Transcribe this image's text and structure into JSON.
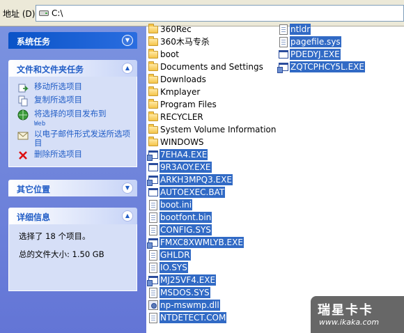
{
  "address": {
    "label": "地址 (D)",
    "path": "C:\\"
  },
  "sidebar": {
    "system_tasks": {
      "title": "系统任务"
    },
    "file_tasks": {
      "title": "文件和文件夹任务",
      "items": [
        {
          "label": "移动所选项目",
          "icon": "move-icon"
        },
        {
          "label": "复制所选项目",
          "icon": "copy-icon"
        },
        {
          "label": "将选择的项目发布到",
          "sub": "Web",
          "icon": "web-publish-icon"
        },
        {
          "label": "以电子邮件形式发送所选项目",
          "icon": "email-icon"
        },
        {
          "label": "删除所选项目",
          "icon": "delete-icon"
        }
      ]
    },
    "other_places": {
      "title": "其它位置"
    },
    "details": {
      "title": "详细信息",
      "selected": "选择了 18 个项目。",
      "total_size": "总的文件大小: 1.50 GB"
    }
  },
  "files": {
    "col1": [
      {
        "name": "360Rec",
        "type": "folder",
        "selected": false
      },
      {
        "name": "360木马专杀",
        "type": "folder",
        "selected": false
      },
      {
        "name": "boot",
        "type": "folder",
        "selected": false
      },
      {
        "name": "Documents and Settings",
        "type": "folder",
        "selected": false
      },
      {
        "name": "Downloads",
        "type": "folder",
        "selected": false
      },
      {
        "name": "Kmplayer",
        "type": "folder",
        "selected": false
      },
      {
        "name": "Program Files",
        "type": "folder",
        "selected": false
      },
      {
        "name": "RECYCLER",
        "type": "folder",
        "selected": false
      },
      {
        "name": "System Volume Information",
        "type": "folder",
        "selected": false
      },
      {
        "name": "WINDOWS",
        "type": "folder",
        "selected": false
      },
      {
        "name": "7EHA4.EXE",
        "type": "exe-alt",
        "selected": true
      },
      {
        "name": "9R3AOY.EXE",
        "type": "exe",
        "selected": true
      },
      {
        "name": "ARKH3MPQ3.EXE",
        "type": "exe-alt",
        "selected": true
      },
      {
        "name": "AUTOEXEC.BAT",
        "type": "exe",
        "selected": true
      },
      {
        "name": "boot.ini",
        "type": "doc",
        "selected": true
      },
      {
        "name": "bootfont.bin",
        "type": "doc",
        "selected": true
      },
      {
        "name": "CONFIG.SYS",
        "type": "doc",
        "selected": true
      },
      {
        "name": "FMXC8XWMLYB.EXE",
        "type": "exe-alt",
        "selected": true
      },
      {
        "name": "GHLDR",
        "type": "doc",
        "selected": true
      },
      {
        "name": "IO.SYS",
        "type": "doc",
        "selected": true
      },
      {
        "name": "MJ25VF4.EXE",
        "type": "exe-alt",
        "selected": true
      },
      {
        "name": "MSDOS.SYS",
        "type": "doc",
        "selected": true
      },
      {
        "name": "np-mswmp.dll",
        "type": "dll",
        "selected": true
      },
      {
        "name": "NTDETECT.COM",
        "type": "doc",
        "selected": true
      }
    ],
    "col2": [
      {
        "name": "ntldr",
        "type": "doc",
        "selected": true
      },
      {
        "name": "pagefile.sys",
        "type": "doc",
        "selected": true
      },
      {
        "name": "PDEDYJ.EXE",
        "type": "exe",
        "selected": true
      },
      {
        "name": "ZQTCPHCY5L.EXE",
        "type": "exe-alt",
        "selected": true
      }
    ]
  },
  "watermark": {
    "title": "瑞星卡卡",
    "url": "www.ikaka.com"
  }
}
